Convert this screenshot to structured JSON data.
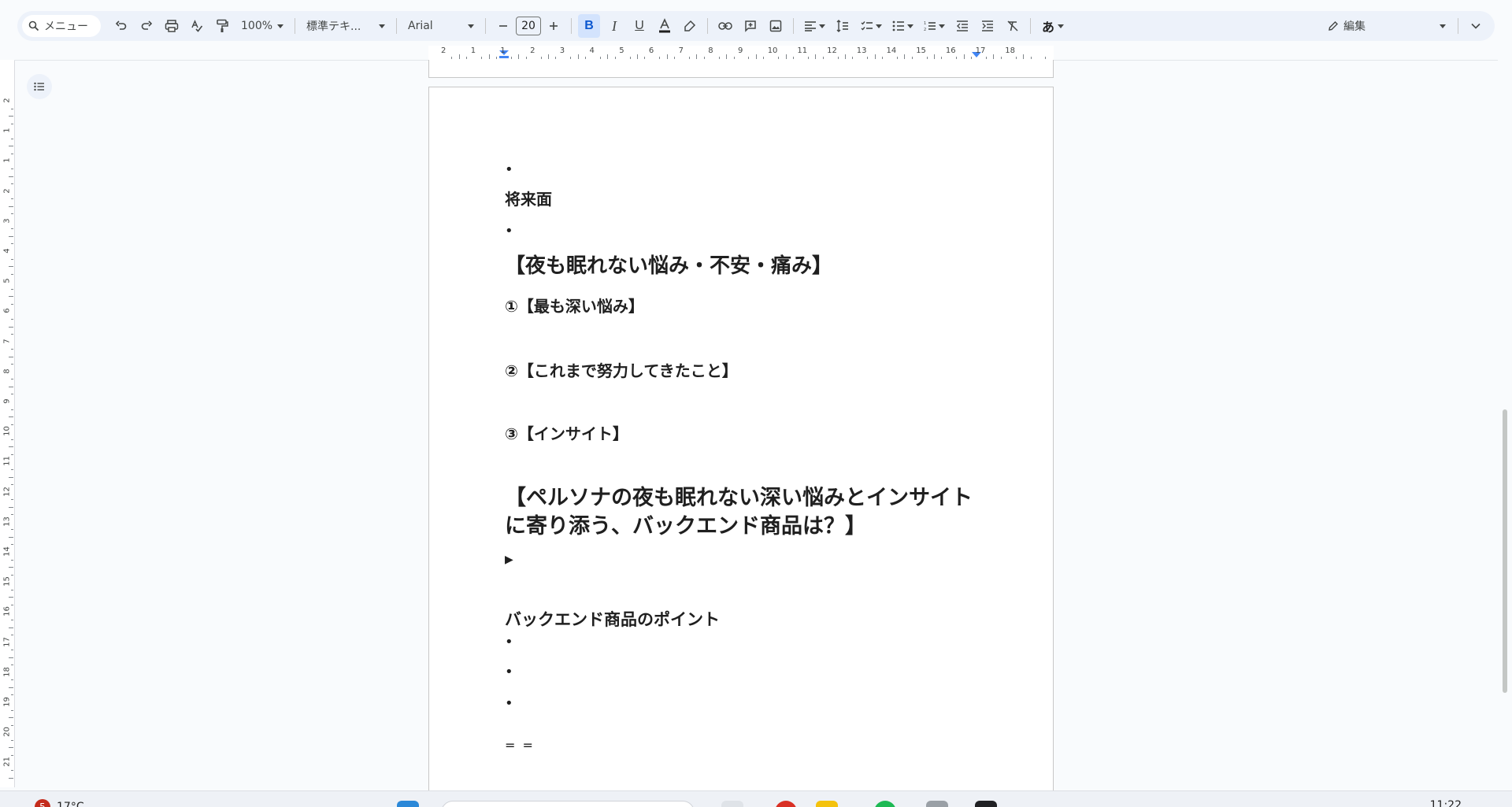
{
  "toolbar": {
    "search_label": "メニュー",
    "zoom": "100%",
    "style": "標準テキ...",
    "font": "Arial",
    "font_size": "20",
    "font_color": "#1f1f1f",
    "input_method": "あ",
    "mode_label": "編集"
  },
  "ruler": {
    "h_labels": [
      "2",
      "1",
      "1",
      "2",
      "3",
      "4",
      "5",
      "6",
      "7",
      "8",
      "9",
      "10",
      "11",
      "12",
      "13",
      "14",
      "15",
      "16",
      "17",
      "18"
    ],
    "v_labels": [
      "2",
      "1",
      "1",
      "2",
      "3",
      "4",
      "5",
      "6",
      "7",
      "8",
      "9",
      "10",
      "11",
      "12",
      "13",
      "14",
      "15",
      "16",
      "17",
      "18",
      "19",
      "20",
      "21"
    ]
  },
  "document": {
    "bullet": "•",
    "line_future": "将来面",
    "heading_worries": "【夜も眠れない悩み・不安・痛み】",
    "item_1": "①【最も深い悩み】",
    "item_2": "②【これまで努力してきたこと】",
    "item_3": "③【インサイト】",
    "heading_backend": "【ペルソナの夜も眠れない深い悩みとインサイトに寄り添う、バックエンド商品は？】",
    "triangle": "▶",
    "backend_points": "バックエンド商品のポイント",
    "separator": "= ="
  },
  "taskbar": {
    "weather_badge": "5",
    "temperature": "17°C",
    "clock": "11:22"
  }
}
